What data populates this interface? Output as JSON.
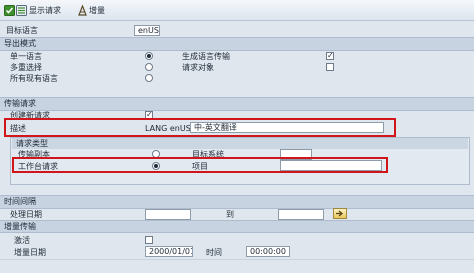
{
  "toolbar": {
    "show_request_label": "显示请求",
    "delta_label": "增量"
  },
  "target_language": {
    "label": "目标语言",
    "value": "enUS"
  },
  "export_mode": {
    "title": "导出模式",
    "single_language": "单一语言",
    "generate_transmission": "生成语言传输",
    "multi_select": "多重选择",
    "request_object": "请求对象",
    "all_existing": "所有现有语言"
  },
  "transport_request": {
    "title": "传输请求",
    "create_new": "创建新请求",
    "description_label": "描述",
    "description_prefix": "LANG enUS",
    "description_value": "中-英文翻译",
    "request_type_title": "请求类型",
    "transport_copy": "传输副本",
    "target_system": "目标系统",
    "workbench_request": "工作台请求",
    "project": "项目"
  },
  "time_interval": {
    "title": "时间间隔",
    "processing_date": "处理日期",
    "to": "到"
  },
  "delta_transport": {
    "title": "增量传输",
    "activate": "激活",
    "delta_date_label": "增量日期",
    "delta_date_value": "2000/01/01",
    "time_label": "时间",
    "time_value": "00:00:00"
  },
  "colors": {
    "highlight": "#d0161b",
    "section_bg": "#c7d3e1",
    "body_bg": "#dfe6ee"
  }
}
